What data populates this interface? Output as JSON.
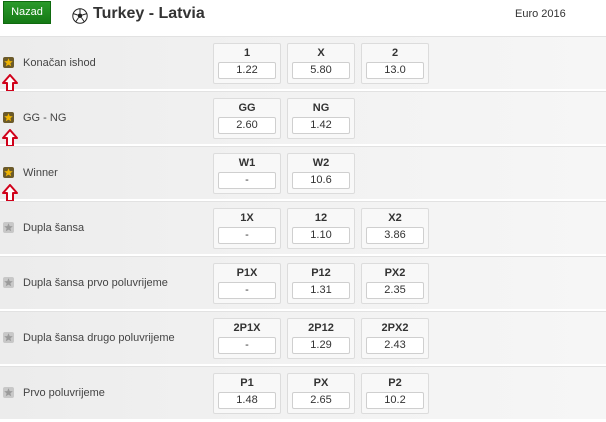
{
  "header": {
    "back_label": "Nazad",
    "match_title": "Turkey - Latvia",
    "tournament": "Euro 2016"
  },
  "colors": {
    "accent_green": "#1e8a1e",
    "star_gold": "#f0b400",
    "arrow_red": "#d0021b"
  },
  "markets": [
    {
      "label": "Konačan ishod",
      "favorite": true,
      "show_arrow": true,
      "odds": [
        {
          "name": "1",
          "value": "1.22"
        },
        {
          "name": "X",
          "value": "5.80"
        },
        {
          "name": "2",
          "value": "13.0"
        }
      ]
    },
    {
      "label": "GG - NG",
      "favorite": true,
      "show_arrow": true,
      "odds": [
        {
          "name": "GG",
          "value": "2.60"
        },
        {
          "name": "NG",
          "value": "1.42"
        }
      ]
    },
    {
      "label": "Winner",
      "favorite": true,
      "show_arrow": true,
      "odds": [
        {
          "name": "W1",
          "value": "-"
        },
        {
          "name": "W2",
          "value": "10.6"
        }
      ]
    },
    {
      "label": "Dupla šansa",
      "favorite": false,
      "show_arrow": false,
      "odds": [
        {
          "name": "1X",
          "value": "-"
        },
        {
          "name": "12",
          "value": "1.10"
        },
        {
          "name": "X2",
          "value": "3.86"
        }
      ]
    },
    {
      "label": "Dupla šansa prvo poluvrijeme",
      "favorite": false,
      "show_arrow": false,
      "odds": [
        {
          "name": "P1X",
          "value": "-"
        },
        {
          "name": "P12",
          "value": "1.31"
        },
        {
          "name": "PX2",
          "value": "2.35"
        }
      ]
    },
    {
      "label": "Dupla šansa drugo poluvrijeme",
      "favorite": false,
      "show_arrow": false,
      "odds": [
        {
          "name": "2P1X",
          "value": "-"
        },
        {
          "name": "2P12",
          "value": "1.29"
        },
        {
          "name": "2PX2",
          "value": "2.43"
        }
      ]
    },
    {
      "label": "Prvo poluvrijeme",
      "favorite": false,
      "show_arrow": false,
      "odds": [
        {
          "name": "P1",
          "value": "1.48"
        },
        {
          "name": "PX",
          "value": "2.65"
        },
        {
          "name": "P2",
          "value": "10.2"
        }
      ]
    }
  ]
}
